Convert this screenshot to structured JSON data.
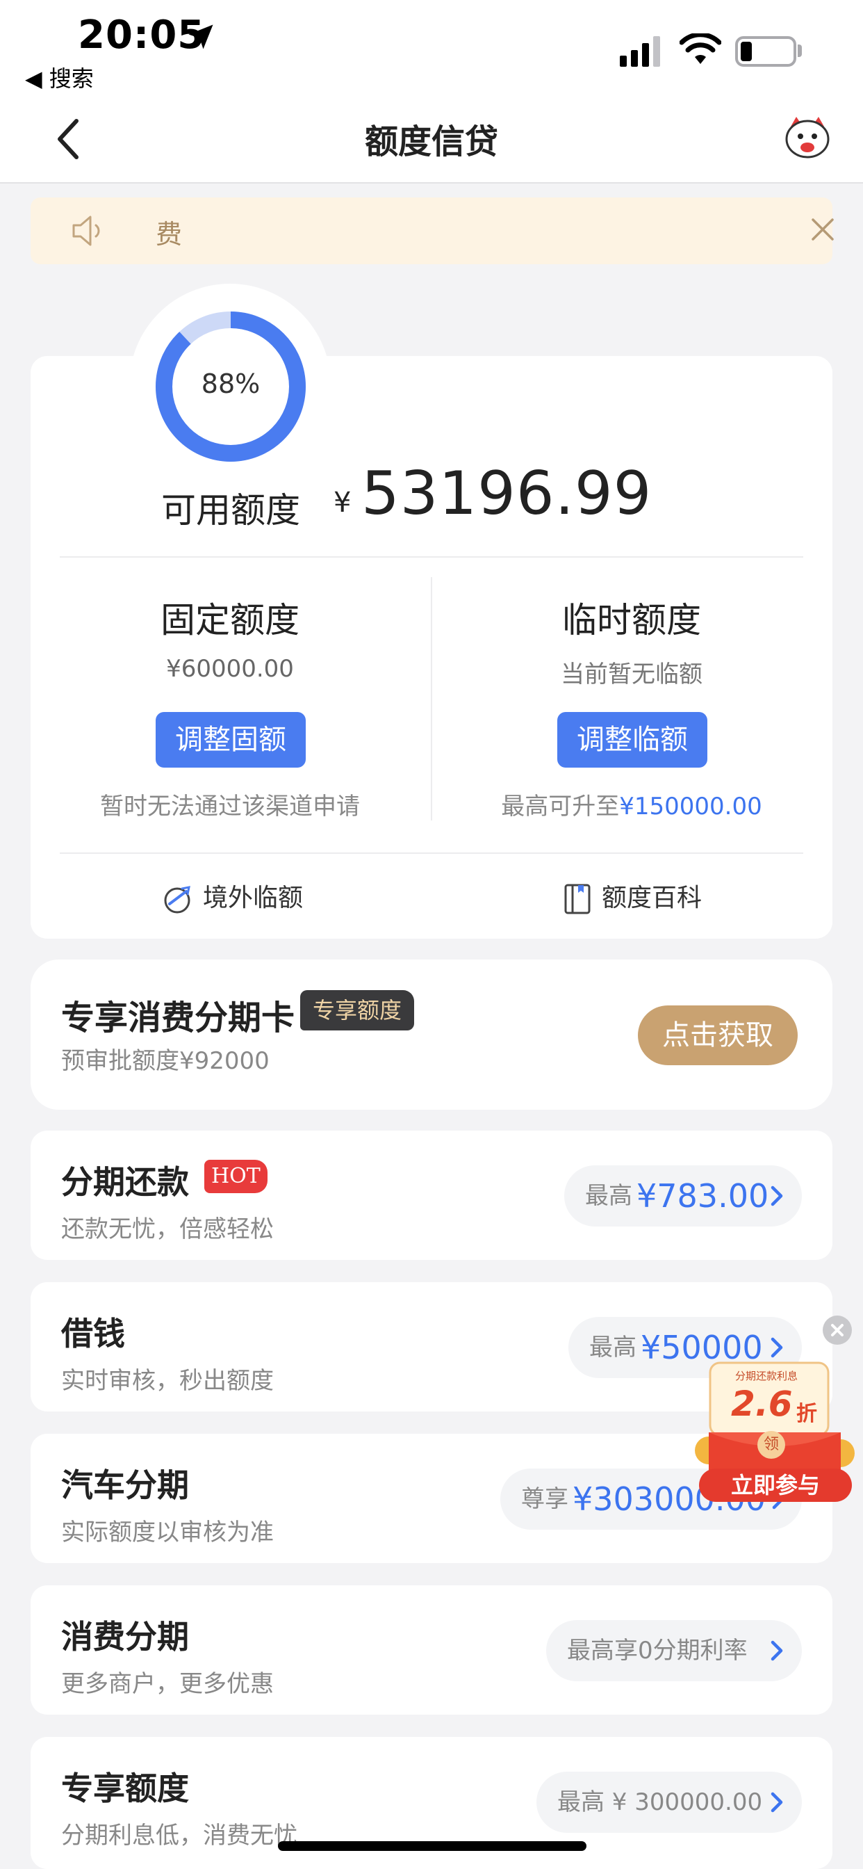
{
  "status_bar": {
    "time": "20:05",
    "back_app": "◀ 搜索",
    "battery_level": 0.15,
    "colors": {
      "battery_outline": "#a9a9ad"
    }
  },
  "nav": {
    "title": "额度信贷",
    "back_icon": "chevron-left-icon",
    "mascot_icon": "mascot-icon"
  },
  "notice": {
    "text": "费",
    "icon": "speaker-icon",
    "close_icon": "close-icon"
  },
  "credit": {
    "usage_percent": "88%",
    "usage_fraction": 0.88,
    "available_label": "可用额度",
    "currency": "¥",
    "available_amount": "53196.99",
    "fixed": {
      "title": "固定额度",
      "amount": "¥60000.00",
      "button": "调整固额",
      "note": "暂时无法通过该渠道申请"
    },
    "temp": {
      "title": "临时额度",
      "status": "当前暂无临额",
      "button": "调整临额",
      "note_prefix": "最高可升至",
      "note_value": "¥150000.00"
    },
    "links": {
      "overseas": "境外临额",
      "wiki": "额度百科"
    }
  },
  "promo": {
    "title": "专享消费分期卡",
    "tag": "专享额度",
    "subtitle": "预审批额度¥92000",
    "button": "点击获取"
  },
  "products": [
    {
      "title": "分期还款",
      "badge": "HOT",
      "subtitle": "还款无忧，倍感轻松",
      "pill_label": "最高",
      "pill_value": "¥783.00"
    },
    {
      "title": "借钱",
      "subtitle": "实时审核，秒出额度",
      "pill_label": "最高",
      "pill_value": "¥50000"
    },
    {
      "title": "汽车分期",
      "subtitle": "实际额度以审核为准",
      "pill_label": "尊享",
      "pill_value": "¥303000.00"
    },
    {
      "title": "消费分期",
      "subtitle": "更多商户，更多优惠",
      "pill_label": "最高享0分期利率",
      "pill_value": ""
    },
    {
      "title": "专享额度",
      "subtitle": "分期利息低，消费无忧",
      "pill_label": "最高 ¥ 300000.00",
      "pill_value": ""
    }
  ],
  "floating_coupon": {
    "caption": "分期还款利息",
    "discount": "2.6",
    "unit": "折",
    "claim": "领",
    "action": "立即参与"
  },
  "colors": {
    "accent_blue": "#4a7cf0",
    "link_blue": "#3c74ef",
    "gold": "#c9a271",
    "hot_red": "#e83b3b",
    "notice_bg": "#fdf3e3"
  }
}
